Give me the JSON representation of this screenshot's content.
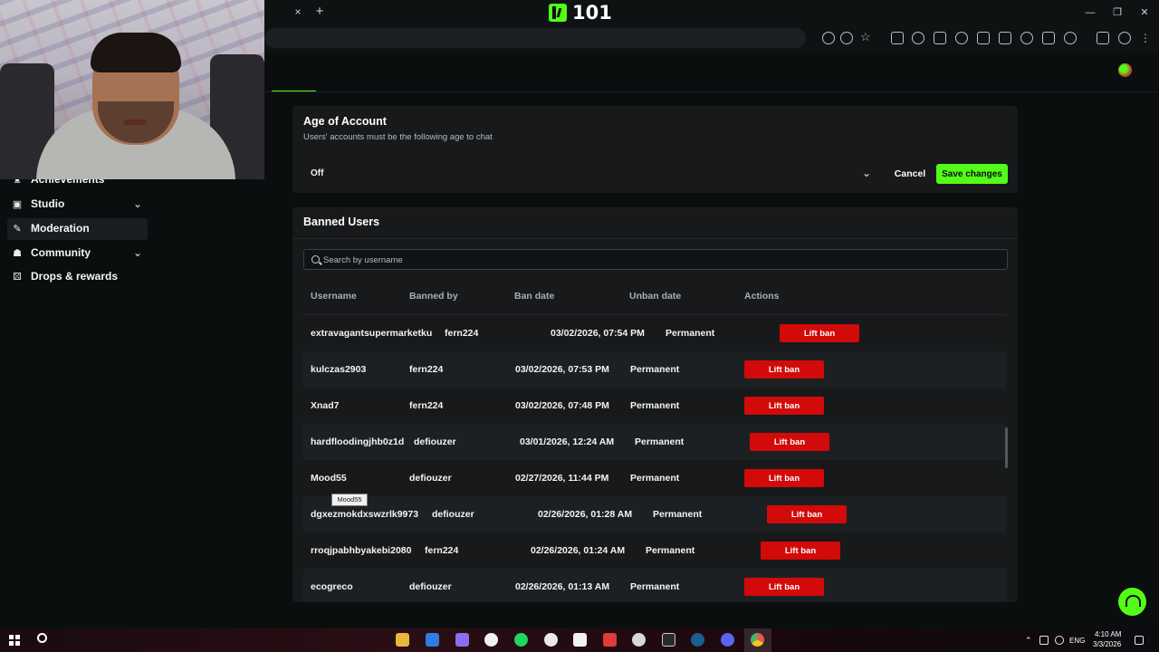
{
  "window": {
    "title": "101",
    "tab_close": "×",
    "tab_new": "+",
    "min": "—",
    "max": "❐",
    "close": "✕"
  },
  "sidebar": {
    "items": [
      {
        "label": "Achievements",
        "icon": "trophy-icon",
        "glyph": "♜"
      },
      {
        "label": "Studio",
        "icon": "studio-icon",
        "glyph": "▣",
        "chevron": "⌄"
      },
      {
        "label": "Moderation",
        "icon": "wrench-icon",
        "glyph": "✎"
      },
      {
        "label": "Community",
        "icon": "people-icon",
        "glyph": "☗",
        "chevron": "⌄"
      },
      {
        "label": "Drops & rewards",
        "icon": "drops-icon",
        "glyph": "⚄"
      }
    ]
  },
  "age_card": {
    "title": "Age of Account",
    "subtitle": "Users' accounts must be the following age to chat",
    "selected": "Off",
    "chevron": "⌄",
    "cancel_label": "Cancel",
    "save_label": "Save changes"
  },
  "banned": {
    "title": "Banned Users",
    "search_placeholder": "Search by username",
    "columns": [
      "Username",
      "Banned by",
      "Ban date",
      "Unban date",
      "Actions"
    ],
    "rows": [
      {
        "username": "extravagantsupermarketku",
        "banned_by": "fern224",
        "ban_date": "03/02/2026, 07:54 PM",
        "unban": "Permanent",
        "action": "Lift ban"
      },
      {
        "username": "kulczas2903",
        "banned_by": "fern224",
        "ban_date": "03/02/2026, 07:53 PM",
        "unban": "Permanent",
        "action": "Lift ban"
      },
      {
        "username": "Xnad7",
        "banned_by": "fern224",
        "ban_date": "03/02/2026, 07:48 PM",
        "unban": "Permanent",
        "action": "Lift ban"
      },
      {
        "username": "hardfloodingjhb0z1d",
        "banned_by": "defiouzer",
        "ban_date": "03/01/2026, 12:24 AM",
        "unban": "Permanent",
        "action": "Lift ban"
      },
      {
        "username": "Mood55",
        "banned_by": "defiouzer",
        "ban_date": "02/27/2026, 11:44 PM",
        "unban": "Permanent",
        "action": "Lift ban"
      },
      {
        "username": "dgxezmokdxswzrlk9973",
        "banned_by": "defiouzer",
        "ban_date": "02/26/2026, 01:28 AM",
        "unban": "Permanent",
        "action": "Lift ban"
      },
      {
        "username": "rroqjpabhbyakebi2080",
        "banned_by": "fern224",
        "ban_date": "02/26/2026, 01:24 AM",
        "unban": "Permanent",
        "action": "Lift ban"
      },
      {
        "username": "ecogreco",
        "banned_by": "defiouzer",
        "ban_date": "02/26/2026, 01:13 AM",
        "unban": "Permanent",
        "action": "Lift ban"
      }
    ],
    "tooltip": "Mood55"
  },
  "taskbar": {
    "lang": "ENG",
    "time": "4:10 AM",
    "date": "3/3/2026",
    "tray_arrow": "⌃"
  },
  "colors": {
    "accent": "#53fc18",
    "danger": "#d20a0a",
    "background": "#0b0e0f",
    "card": "#17191b"
  }
}
